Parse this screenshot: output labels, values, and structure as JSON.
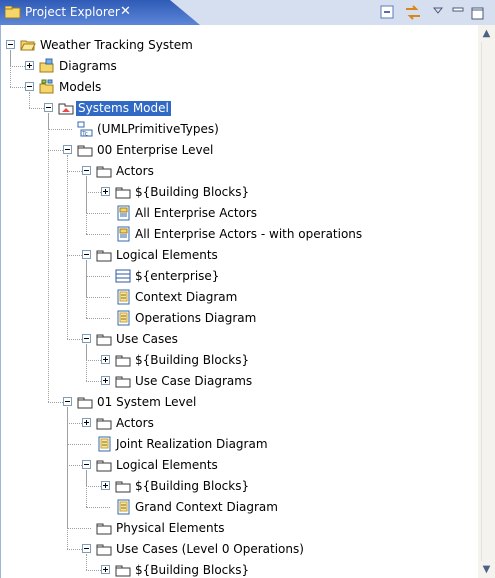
{
  "view": {
    "title": "Project Explorer",
    "close_glyph": "✕",
    "toolbar": [
      "collapse-all-icon",
      "link-with-editor-icon",
      "view-menu-icon",
      "minimize-icon",
      "maximize-icon"
    ]
  },
  "tree": [
    {
      "label": "Weather Tracking System",
      "depth": 0,
      "icon": "folder-open-icon",
      "twisty": "minus"
    },
    {
      "label": "Diagrams",
      "depth": 1,
      "icon": "diagrams-folder-icon",
      "twisty": "plus"
    },
    {
      "label": "Models",
      "depth": 1,
      "icon": "models-folder-icon",
      "twisty": "minus"
    },
    {
      "label": "Systems Model",
      "depth": 2,
      "icon": "model-package-icon",
      "twisty": "minus",
      "selected": true
    },
    {
      "label": "(UMLPrimitiveTypes)",
      "depth": 3,
      "icon": "model-library-icon",
      "twisty": "none"
    },
    {
      "label": "00 Enterprise Level",
      "depth": 3,
      "icon": "package-icon",
      "twisty": "minus"
    },
    {
      "label": "Actors",
      "depth": 4,
      "icon": "package-icon",
      "twisty": "minus"
    },
    {
      "label": "${Building Blocks}",
      "depth": 5,
      "icon": "package-icon",
      "twisty": "plus"
    },
    {
      "label": "All Enterprise Actors",
      "depth": 5,
      "icon": "diagram-icon",
      "twisty": "none"
    },
    {
      "label": "All Enterprise Actors - with operations",
      "depth": 5,
      "icon": "diagram-icon",
      "twisty": "none"
    },
    {
      "label": "Logical Elements",
      "depth": 4,
      "icon": "package-icon",
      "twisty": "minus"
    },
    {
      "label": "${enterprise}",
      "depth": 5,
      "icon": "class-icon",
      "twisty": "none"
    },
    {
      "label": "Context Diagram",
      "depth": 5,
      "icon": "document-icon",
      "twisty": "none"
    },
    {
      "label": "Operations Diagram",
      "depth": 5,
      "icon": "document-icon",
      "twisty": "none"
    },
    {
      "label": "Use Cases",
      "depth": 4,
      "icon": "package-icon",
      "twisty": "minus"
    },
    {
      "label": "${Building Blocks}",
      "depth": 5,
      "icon": "package-icon",
      "twisty": "plus"
    },
    {
      "label": "Use Case Diagrams",
      "depth": 5,
      "icon": "package-icon",
      "twisty": "plus"
    },
    {
      "label": "01 System Level",
      "depth": 3,
      "icon": "package-icon",
      "twisty": "minus"
    },
    {
      "label": "Actors",
      "depth": 4,
      "icon": "package-icon",
      "twisty": "plus"
    },
    {
      "label": "Joint Realization Diagram",
      "depth": 4,
      "icon": "document-icon",
      "twisty": "none"
    },
    {
      "label": "Logical Elements",
      "depth": 4,
      "icon": "package-icon",
      "twisty": "minus"
    },
    {
      "label": "${Building Blocks}",
      "depth": 5,
      "icon": "package-icon",
      "twisty": "plus"
    },
    {
      "label": "Grand Context Diagram",
      "depth": 5,
      "icon": "document-icon",
      "twisty": "none"
    },
    {
      "label": "Physical Elements",
      "depth": 4,
      "icon": "package-icon",
      "twisty": "none"
    },
    {
      "label": "Use Cases (Level 0 Operations)",
      "depth": 4,
      "icon": "package-icon",
      "twisty": "minus"
    },
    {
      "label": "${Building Blocks}",
      "depth": 5,
      "icon": "package-icon",
      "twisty": "plus"
    }
  ],
  "scrollbar": {
    "up": "▲",
    "down": "▼"
  },
  "colors": {
    "selection": "#316ac5",
    "tab": "#2f5bb7",
    "folder": "#f5d66a"
  }
}
